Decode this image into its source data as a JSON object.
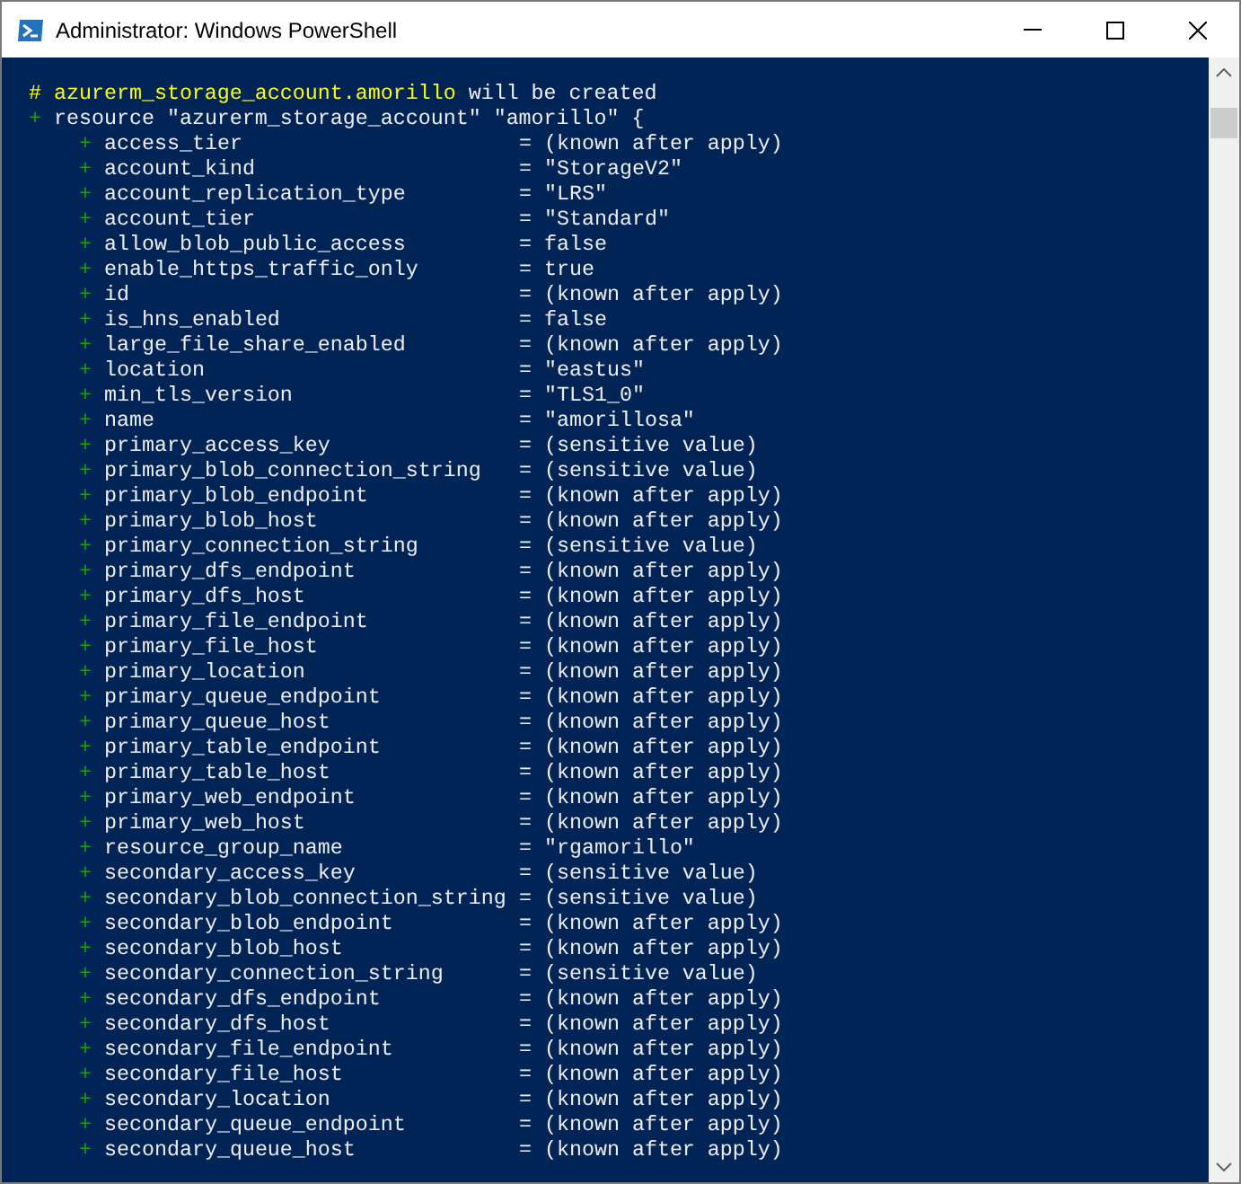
{
  "window": {
    "title": "Administrator: Windows PowerShell"
  },
  "console": {
    "header": {
      "address": "# azurerm_storage_account.amorillo",
      "note": "will be created"
    },
    "resource": {
      "sign": "+",
      "text": "resource \"azurerm_storage_account\" \"amorillo\" {"
    },
    "attributes": [
      {
        "sign": "+",
        "name": "access_tier",
        "value": "= (known after apply)"
      },
      {
        "sign": "+",
        "name": "account_kind",
        "value": "= \"StorageV2\""
      },
      {
        "sign": "+",
        "name": "account_replication_type",
        "value": "= \"LRS\""
      },
      {
        "sign": "+",
        "name": "account_tier",
        "value": "= \"Standard\""
      },
      {
        "sign": "+",
        "name": "allow_blob_public_access",
        "value": "= false"
      },
      {
        "sign": "+",
        "name": "enable_https_traffic_only",
        "value": "= true"
      },
      {
        "sign": "+",
        "name": "id",
        "value": "= (known after apply)"
      },
      {
        "sign": "+",
        "name": "is_hns_enabled",
        "value": "= false"
      },
      {
        "sign": "+",
        "name": "large_file_share_enabled",
        "value": "= (known after apply)"
      },
      {
        "sign": "+",
        "name": "location",
        "value": "= \"eastus\""
      },
      {
        "sign": "+",
        "name": "min_tls_version",
        "value": "= \"TLS1_0\""
      },
      {
        "sign": "+",
        "name": "name",
        "value": "= \"amorillosa\""
      },
      {
        "sign": "+",
        "name": "primary_access_key",
        "value": "= (sensitive value)"
      },
      {
        "sign": "+",
        "name": "primary_blob_connection_string",
        "value": "= (sensitive value)"
      },
      {
        "sign": "+",
        "name": "primary_blob_endpoint",
        "value": "= (known after apply)"
      },
      {
        "sign": "+",
        "name": "primary_blob_host",
        "value": "= (known after apply)"
      },
      {
        "sign": "+",
        "name": "primary_connection_string",
        "value": "= (sensitive value)"
      },
      {
        "sign": "+",
        "name": "primary_dfs_endpoint",
        "value": "= (known after apply)"
      },
      {
        "sign": "+",
        "name": "primary_dfs_host",
        "value": "= (known after apply)"
      },
      {
        "sign": "+",
        "name": "primary_file_endpoint",
        "value": "= (known after apply)"
      },
      {
        "sign": "+",
        "name": "primary_file_host",
        "value": "= (known after apply)"
      },
      {
        "sign": "+",
        "name": "primary_location",
        "value": "= (known after apply)"
      },
      {
        "sign": "+",
        "name": "primary_queue_endpoint",
        "value": "= (known after apply)"
      },
      {
        "sign": "+",
        "name": "primary_queue_host",
        "value": "= (known after apply)"
      },
      {
        "sign": "+",
        "name": "primary_table_endpoint",
        "value": "= (known after apply)"
      },
      {
        "sign": "+",
        "name": "primary_table_host",
        "value": "= (known after apply)"
      },
      {
        "sign": "+",
        "name": "primary_web_endpoint",
        "value": "= (known after apply)"
      },
      {
        "sign": "+",
        "name": "primary_web_host",
        "value": "= (known after apply)"
      },
      {
        "sign": "+",
        "name": "resource_group_name",
        "value": "= \"rgamorillo\""
      },
      {
        "sign": "+",
        "name": "secondary_access_key",
        "value": "= (sensitive value)"
      },
      {
        "sign": "+",
        "name": "secondary_blob_connection_string",
        "value": "= (sensitive value)"
      },
      {
        "sign": "+",
        "name": "secondary_blob_endpoint",
        "value": "= (known after apply)"
      },
      {
        "sign": "+",
        "name": "secondary_blob_host",
        "value": "= (known after apply)"
      },
      {
        "sign": "+",
        "name": "secondary_connection_string",
        "value": "= (sensitive value)"
      },
      {
        "sign": "+",
        "name": "secondary_dfs_endpoint",
        "value": "= (known after apply)"
      },
      {
        "sign": "+",
        "name": "secondary_dfs_host",
        "value": "= (known after apply)"
      },
      {
        "sign": "+",
        "name": "secondary_file_endpoint",
        "value": "= (known after apply)"
      },
      {
        "sign": "+",
        "name": "secondary_file_host",
        "value": "= (known after apply)"
      },
      {
        "sign": "+",
        "name": "secondary_location",
        "value": "= (known after apply)"
      },
      {
        "sign": "+",
        "name": "secondary_queue_endpoint",
        "value": "= (known after apply)"
      },
      {
        "sign": "+",
        "name": "secondary_queue_host",
        "value": "= (known after apply)"
      }
    ]
  }
}
